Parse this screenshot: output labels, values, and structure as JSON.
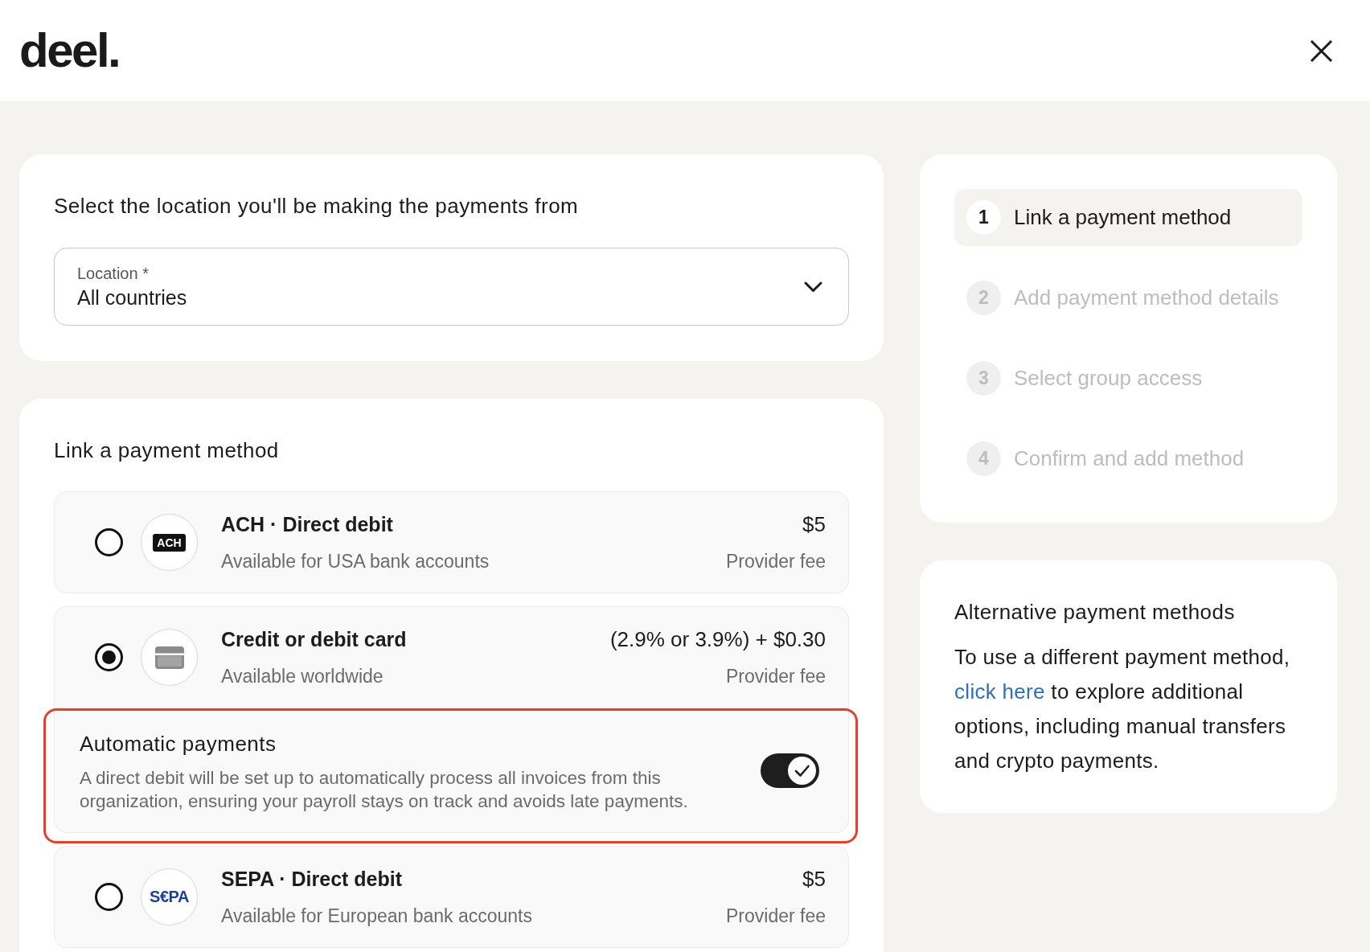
{
  "header": {
    "logo": "deel."
  },
  "location_card": {
    "title": "Select the location you'll be making the payments from",
    "location_field": {
      "label": "Location *",
      "value": "All countries"
    }
  },
  "payment_methods": {
    "title": "Link a payment method",
    "methods": [
      {
        "kind": "ach",
        "logo_text": "ACH",
        "name": "ACH · Direct debit",
        "description": "Available for USA bank accounts",
        "fee": "$5",
        "fee_label": "Provider fee",
        "selected": false
      },
      {
        "kind": "card",
        "name": "Credit or debit card",
        "description": "Available worldwide",
        "fee": "(2.9% or 3.9%) + $0.30",
        "fee_label": "Provider fee",
        "selected": true,
        "automatic_payments": {
          "title": "Automatic payments",
          "description": "A direct debit will be set up to automatically process all invoices from this organization, ensuring your payroll stays on track and avoids late payments.",
          "on": true,
          "highlighted": true
        }
      },
      {
        "kind": "sepa",
        "logo_text": "S€PA",
        "name": "SEPA · Direct debit",
        "description": "Available for European bank accounts",
        "fee": "$5",
        "fee_label": "Provider fee",
        "selected": false
      }
    ]
  },
  "steps": [
    {
      "number": "1",
      "label": "Link a payment method",
      "selected": true
    },
    {
      "number": "2",
      "label": "Add payment method details",
      "selected": false
    },
    {
      "number": "3",
      "label": "Select group access",
      "selected": false
    },
    {
      "number": "4",
      "label": "Confirm and add method",
      "selected": false
    }
  ],
  "alternative_methods": {
    "title": "Alternative payment methods",
    "text_before": "To use a different payment method,",
    "link": "click here",
    "text_after": "to explore additional options, including manual transfers and crypto payments."
  }
}
